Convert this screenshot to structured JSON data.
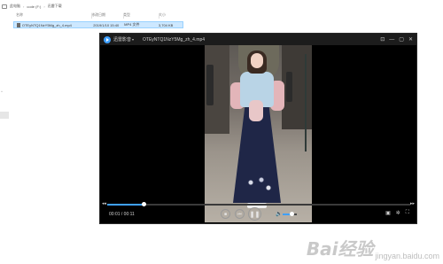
{
  "explorer": {
    "breadcrumb": [
      "此电脑",
      "code (F:)",
      "迅雷下载"
    ],
    "columns": {
      "name": "名称",
      "date": "修改日期",
      "type": "类型",
      "size": "大小"
    },
    "file": {
      "name": "OTEyNTQ1NzY5Mg_zh_4.mp4",
      "date": "2019/1/10 15:40",
      "type": "MP4 文件",
      "size": "3,704 KB"
    },
    "side_label": "^"
  },
  "player": {
    "app_name": "迅雷影音",
    "app_caret": "▾",
    "file_title": "OTEyNTQ1NzY5Mg_zh_4.mp4",
    "title_icons": [
      {
        "name": "pin-icon",
        "glyph": "⊡"
      },
      {
        "name": "minimize-icon",
        "glyph": "—"
      },
      {
        "name": "maximize-icon",
        "glyph": "▢"
      },
      {
        "name": "close-icon",
        "glyph": "✕"
      }
    ],
    "time": "00:01 / 00:11",
    "progress_fraction": 0.12,
    "volume_fraction": 0.6,
    "seek_back": "◂◂",
    "seek_forward": "▸▸",
    "controls": {
      "stop": "■",
      "prev": "⏮",
      "play": "❚❚"
    },
    "volume_glyph": "🔈",
    "bottom_right_icons": [
      {
        "name": "screenshot-icon",
        "glyph": "▣"
      },
      {
        "name": "settings-icon",
        "glyph": "✲"
      },
      {
        "name": "fullscreen-icon",
        "glyph": "⛶"
      }
    ]
  },
  "watermark": {
    "main": "Bai经验",
    "sub": "jingyan.baidu.com"
  }
}
